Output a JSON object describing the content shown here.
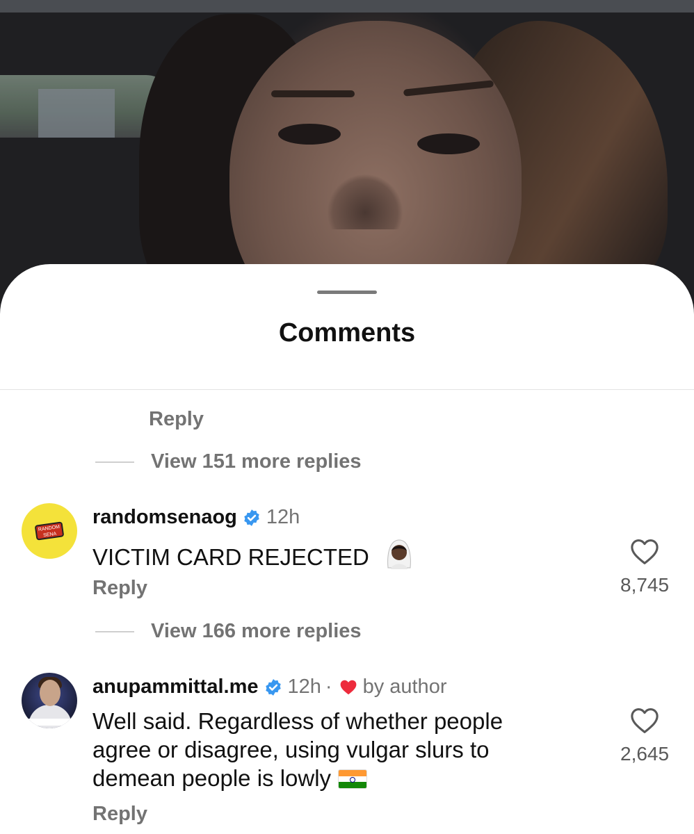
{
  "sheet": {
    "title": "Comments"
  },
  "prev_thread": {
    "reply_label": "Reply",
    "view_replies": "View 151 more replies"
  },
  "comments": [
    {
      "username": "randomsenaog",
      "verified": true,
      "time": "12h",
      "text": "VICTIM CARD REJECTED",
      "emoji": "bride-with-veil",
      "reply_label": "Reply",
      "likes": "8,745",
      "view_replies": "View 166 more replies",
      "avatar_icon": "random-sena-logo"
    },
    {
      "username": "anupammittal.me",
      "verified": true,
      "time": "12h",
      "separator": "·",
      "liked_by_author": "by author",
      "text_lines": [
        "Well said. Regardless of whether people",
        "agree or disagree, using vulgar slurs to",
        "demean people is lowly"
      ],
      "emoji": "india-flag",
      "reply_label": "Reply",
      "likes": "2,645",
      "avatar_icon": "astronaut-avatar"
    }
  ],
  "colors": {
    "verified_blue": "#3897f0",
    "heart_red": "#ed2b3c",
    "secondary_text": "#737373"
  }
}
